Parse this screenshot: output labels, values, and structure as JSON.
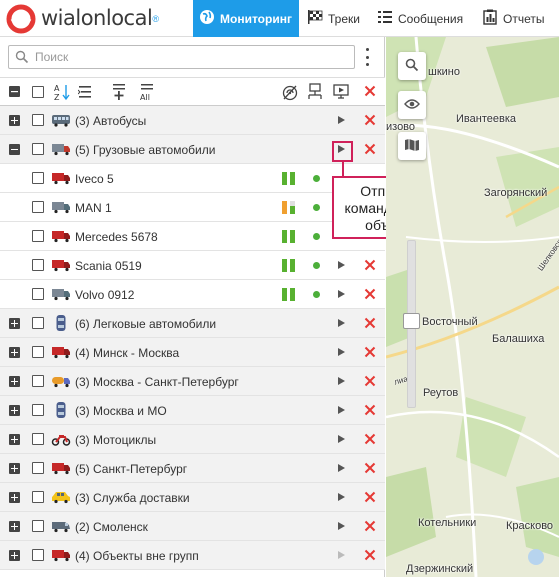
{
  "app": {
    "logo_text": "wialonlocal",
    "logo_sup": "®"
  },
  "nav": {
    "monitoring": "Мониторинг",
    "tracks": "Треки",
    "messages": "Сообщения",
    "reports": "Отчеты"
  },
  "search": {
    "placeholder": "Поиск",
    "value": ""
  },
  "toolbar": {
    "all_label": "All"
  },
  "groups_top": [
    {
      "label": "(3) Автобусы",
      "icon": "bus-icon",
      "expanded": false
    },
    {
      "label": "(5) Грузовые автомобили",
      "icon": "truck-icon",
      "expanded": true
    }
  ],
  "units": [
    {
      "label": "Iveco 5",
      "icon": "red-truck-icon",
      "bars": [
        "#58b130",
        "#58b130"
      ]
    },
    {
      "label": "MAN 1",
      "icon": "truck-icon",
      "bars": [
        "#f0a030",
        "#58b130"
      ]
    },
    {
      "label": "Mercedes 5678",
      "icon": "red-truck-icon",
      "bars": [
        "#58b130",
        "#58b130"
      ]
    },
    {
      "label": "Scania 0519",
      "icon": "red-truck-icon",
      "bars": [
        "#58b130",
        "#58b130"
      ]
    },
    {
      "label": "Volvo 0912",
      "icon": "truck-icon",
      "bars": [
        "#58b130",
        "#58b130"
      ]
    }
  ],
  "groups_bottom": [
    {
      "label": "(6) Легковые автомобили",
      "icon": "car-icon"
    },
    {
      "label": "(4) Минск - Москва",
      "icon": "red-truck-icon"
    },
    {
      "label": "(3) Москва - Санкт-Петербург",
      "icon": "tanker-icon"
    },
    {
      "label": "(3) Москва и МО",
      "icon": "car-icon"
    },
    {
      "label": "(3) Мотоциклы",
      "icon": "motorcycle-icon"
    },
    {
      "label": "(5) Санкт-Петербург",
      "icon": "red-truck-icon"
    },
    {
      "label": "(3) Служба доставки",
      "icon": "taxi-icon"
    },
    {
      "label": "(2) Смоленск",
      "icon": "van-icon"
    },
    {
      "label": "(4) Объекты вне групп",
      "icon": "red-truck-icon"
    }
  ],
  "callout": {
    "line1": "Отправить",
    "line2": "команду группе",
    "line3": "объектов"
  },
  "map": {
    "labels": [
      "шкино",
      "Ивантеевка",
      "изово",
      "Загорянский",
      "Восточный",
      "Балашиха",
      "Реутов",
      "Котельники",
      "Красково",
      "Дзержинский",
      "Шелковское",
      "лиаст"
    ]
  },
  "colors": {
    "accent": "#1e9ce8",
    "close": "#e53935",
    "highlight": "#d0215a"
  }
}
